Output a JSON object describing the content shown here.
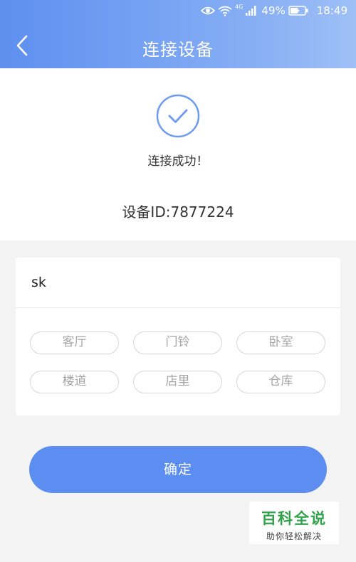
{
  "status_bar": {
    "network": "4G",
    "battery": "49%",
    "time": "18:49"
  },
  "nav": {
    "title": "连接设备"
  },
  "success": {
    "message": "连接成功！",
    "device_id_label": "设备ID:",
    "device_id_value": "7877224"
  },
  "name_field": {
    "value": "sk"
  },
  "tags": [
    "客厅",
    "门铃",
    "卧室",
    "楼道",
    "店里",
    "仓库"
  ],
  "confirm_label": "确定",
  "watermark": {
    "title": "百科全说",
    "subtitle": "助你轻松解决"
  },
  "colors": {
    "accent": "#5b8ef0",
    "header_gradient_start": "#5e8ff0",
    "header_gradient_end": "#9fc0f6",
    "watermark_green": "#2fa24a"
  }
}
